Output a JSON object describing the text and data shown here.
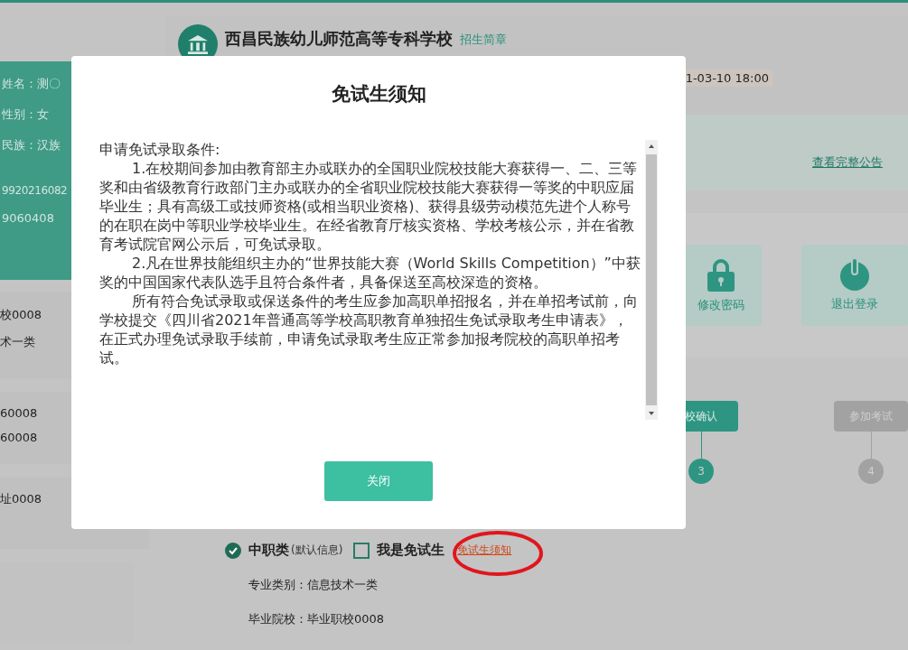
{
  "profile": {
    "fields": [
      "姓名：测〇",
      "性别：女",
      "民族：汉族",
      "9920216082",
      "9060408"
    ]
  },
  "left_cards": [
    [
      "校0008",
      "术一类"
    ],
    [
      "60008",
      "60008"
    ],
    [
      "址0008"
    ]
  ],
  "school": {
    "name": "西昌民族幼儿师范高等专科学校",
    "link": "招生简章",
    "date": "1-03-10 18:00"
  },
  "notice": {
    "link": "查看完整公告"
  },
  "tiles": [
    {
      "kind": "lock",
      "label": "修改密码"
    },
    {
      "kind": "power",
      "label": "退出登录"
    }
  ],
  "steps": [
    {
      "label": "校确认",
      "number": "3",
      "done": true
    },
    {
      "label": "参加考试",
      "number": "4",
      "done": false
    }
  ],
  "category": {
    "checked": true,
    "label": "中职类",
    "hint": "(默认信息)",
    "exempt_checked": false,
    "exempt_label": "我是免试生",
    "exempt_link": "免试生须知"
  },
  "details": [
    "专业类别：信息技术一类",
    "毕业院校：毕业职校0008"
  ],
  "modal": {
    "title": "免试生须知",
    "heading": "申请免试录取条件:",
    "paragraphs": [
      "1.在校期间参加由教育部主办或联办的全国职业院校技能大赛获得一、二、三等奖和由省级教育行政部门主办或联办的全省职业院校技能大赛获得一等奖的中职应届毕业生；具有高级工或技师资格(或相当职业资格)、获得县级劳动模范先进个人称号的在职在岗中等职业学校毕业生。在经省教育厅核实资格、学校考核公示，并在省教育考试院官网公示后，可免试录取。",
      "2.凡在世界技能组织主办的“世界技能大赛（World Skills Competition）”中获奖的中国国家代表队选手且符合条件者，具备保送至高校深造的资格。",
      "所有符合免试录取或保送条件的考生应参加高职单招报名，并在单招考试前，向学校提交《四川省2021年普通高等学校高职教育单独招生免试录取考生申请表》，在正式办理免试录取手续前，申请免试录取考生应正常参加报考院校的高职单招考试。"
    ],
    "close": "关闭"
  }
}
